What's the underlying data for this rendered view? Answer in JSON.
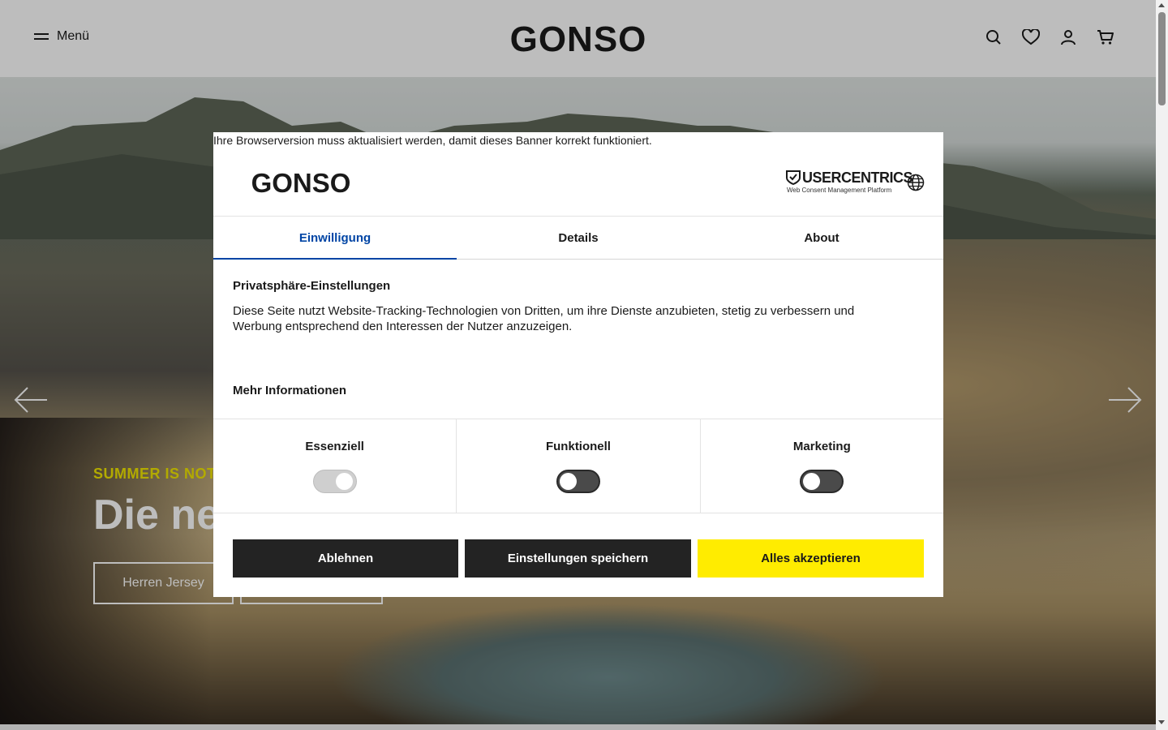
{
  "header": {
    "menu_label": "Menü",
    "brand": "GONSO",
    "icons": [
      "search-icon",
      "heart-icon",
      "user-icon",
      "cart-icon"
    ]
  },
  "hero": {
    "kicker": "SUMMER IS NOT OVER",
    "title": "Die ne",
    "buttons": [
      "Herren Jersey",
      ""
    ]
  },
  "dialog": {
    "browser_warning": "Ihre Browserversion muss aktualisiert werden, damit dieses Banner korrekt funktioniert.",
    "brand": "GONSO",
    "provider": {
      "name": "USERCENTRICS",
      "tagline": "Web Consent Management Platform"
    },
    "tabs": [
      {
        "label": "Einwilligung",
        "active": true
      },
      {
        "label": "Details",
        "active": false
      },
      {
        "label": "About",
        "active": false
      }
    ],
    "section_title": "Privatsphäre-Einstellungen",
    "section_body": "Diese Seite nutzt Website-Tracking-Technologien von Dritten, um ihre Dienste anzubieten, stetig zu verbessern und Werbung entsprechend den Interessen der Nutzer anzuzeigen.",
    "more_info": "Mehr Informationen",
    "categories": [
      {
        "label": "Essenziell",
        "enabled": true,
        "locked": true
      },
      {
        "label": "Funktionell",
        "enabled": false,
        "locked": false
      },
      {
        "label": "Marketing",
        "enabled": false,
        "locked": false
      }
    ],
    "actions": {
      "reject": "Ablehnen",
      "save": "Einstellungen speichern",
      "accept": "Alles akzeptieren"
    }
  },
  "colors": {
    "accent_yellow": "#ffec00",
    "tab_active": "#0045a5",
    "dark_button": "#232323",
    "kicker": "#f1e600"
  }
}
